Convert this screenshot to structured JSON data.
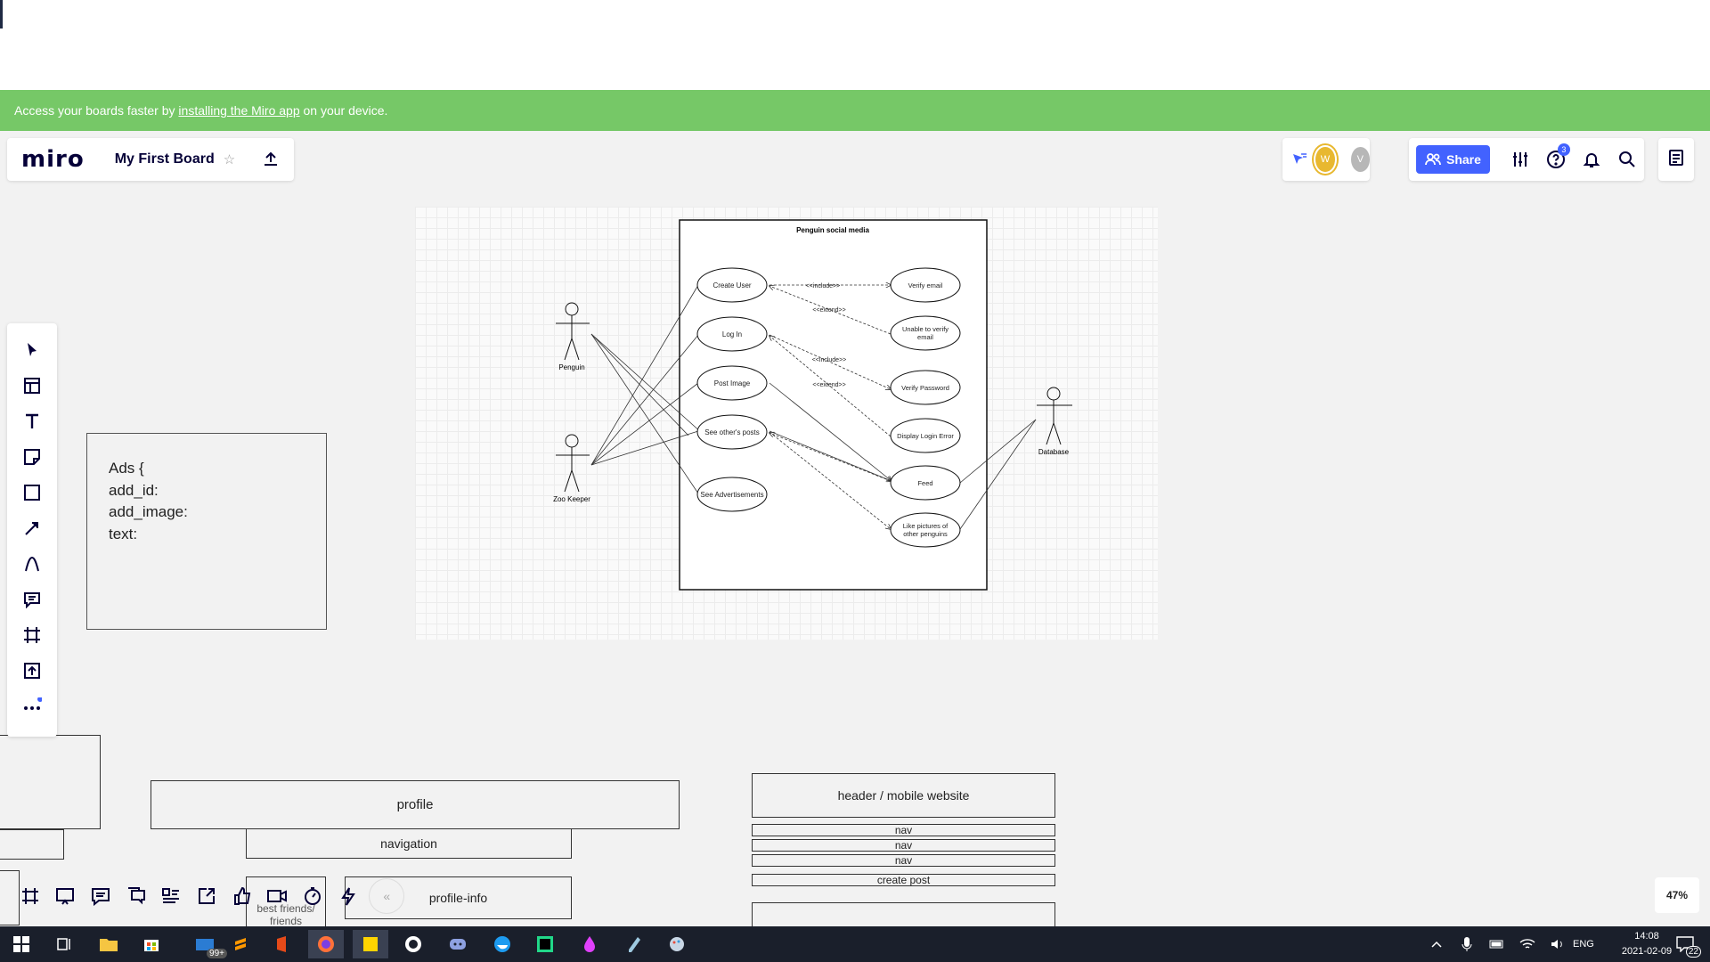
{
  "banner": {
    "prefix": "Access your boards faster by ",
    "link": "installing the Miro app",
    "suffix": " on your device."
  },
  "header": {
    "logo": "miro",
    "board_title": "My First Board",
    "avatar_w": "W",
    "avatar_v": "V",
    "share_label": "Share",
    "help_badge": "3"
  },
  "diagram": {
    "title": "Penguin social media",
    "actors": [
      "Penguin",
      "Zoo Keeper",
      "Database"
    ],
    "use_cases_left": [
      "Create User",
      "Log In",
      "Post Image",
      "See other's posts",
      "See Advertisements"
    ],
    "use_cases_right": [
      "Verify email",
      "Unable to verify",
      "email",
      "Verify Password",
      "Display Login Error",
      "Feed",
      "Like pictures of",
      "other penguins"
    ],
    "relations": [
      "<<include>>",
      "<<extend>>",
      "<<include>>",
      "<<extend>>"
    ]
  },
  "ads": {
    "line1": "Ads {",
    "line2": "add_id:",
    "line3": "add_image:",
    "line4": "text:"
  },
  "wireframes": {
    "profile": "profile",
    "navigation": "navigation",
    "profile_info": "profile-info",
    "best_friends": "best friends/",
    "friends": "friends",
    "header_mobile": "header / mobile website",
    "nav": [
      "nav",
      "nav",
      "nav"
    ],
    "create_post": "create post"
  },
  "zoom": "47%",
  "taskbar": {
    "mail_badge": "99+",
    "language": "ENG",
    "time": "14:08",
    "date": "2021-02-09",
    "notifications": "22"
  },
  "colors": {
    "banner": "#76c867",
    "accent": "#4262ff",
    "taskbar": "#1a1f2b"
  }
}
